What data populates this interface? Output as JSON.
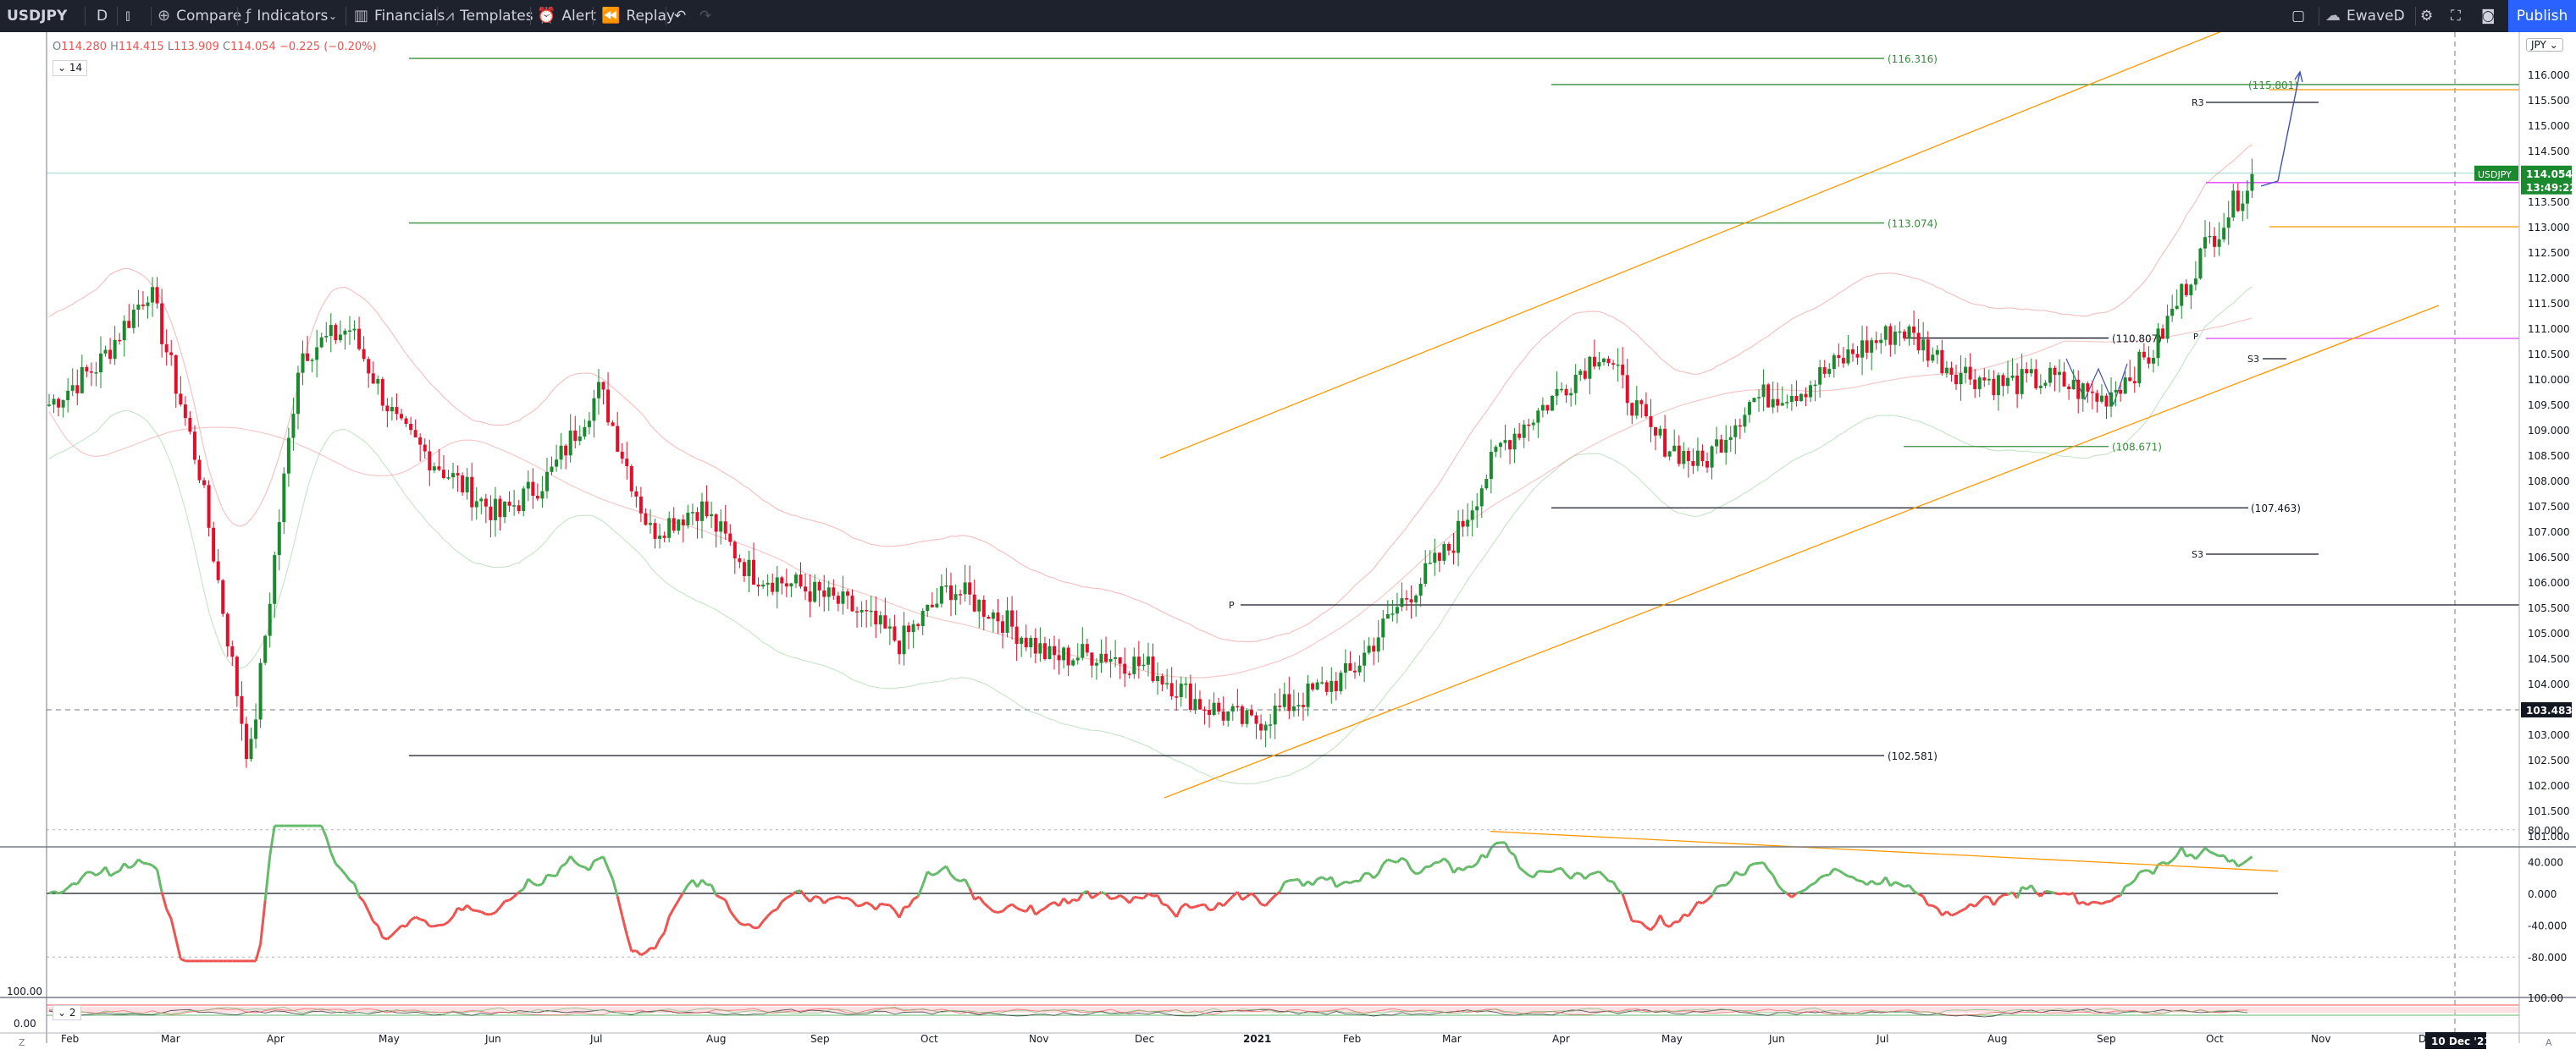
{
  "toolbar": {
    "symbol": "USDJPY",
    "interval": "D",
    "compare": "Compare",
    "indicators": "Indicators",
    "financials": "Financials",
    "templates": "Templates",
    "alert": "Alert",
    "replay": "Replay",
    "layout_name": "EwaveD",
    "publish": "Publish"
  },
  "legend": {
    "open_key": "O",
    "open": "114.280",
    "high_key": "H",
    "high": "114.415",
    "low_key": "L",
    "low": "113.909",
    "close_key": "C",
    "close": "114.054",
    "change": "−0.225 (−0.20%)",
    "indicator_param": "14",
    "sub_indicator_param": "2"
  },
  "currency": "JPY",
  "price_axis": {
    "ticks": [
      "116.000",
      "115.500",
      "115.000",
      "114.500",
      "114.000",
      "113.500",
      "113.000",
      "112.500",
      "112.000",
      "111.500",
      "111.000",
      "110.500",
      "110.000",
      "109.500",
      "109.000",
      "108.500",
      "108.000",
      "107.500",
      "107.000",
      "106.500",
      "106.000",
      "105.500",
      "105.000",
      "104.500",
      "104.000",
      "103.500",
      "103.000",
      "102.500",
      "102.000",
      "101.500",
      "101.000"
    ],
    "symbol_tag": "USDJPY",
    "last_price": "114.054",
    "countdown": "13:49:22",
    "crosshair_price": "103.483"
  },
  "osc_axis": {
    "ticks": [
      "80.000",
      "40.000",
      "0.000",
      "-40.000",
      "-80.000"
    ]
  },
  "sub_axis": {
    "left_top": "100.00",
    "left_bottom": "0.00",
    "right_top": "100.00"
  },
  "time_axis": {
    "labels": [
      "Feb",
      "Mar",
      "Apr",
      "May",
      "Jun",
      "Jul",
      "Aug",
      "Sep",
      "Oct",
      "Nov",
      "Dec",
      "2021",
      "Feb",
      "Mar",
      "Apr",
      "May",
      "Jun",
      "Jul",
      "Aug",
      "Sep",
      "Oct",
      "Nov",
      "Dec"
    ],
    "crosshair_date": "10 Dec '21",
    "scale_left": "Z",
    "scale_right": "A"
  },
  "levels": [
    {
      "label": "(116.316)",
      "color": "#388e3c"
    },
    {
      "label": "(115.801)",
      "color": "#388e3c"
    },
    {
      "label": "(113.074)",
      "color": "#388e3c"
    },
    {
      "label": "(110.807)",
      "color": "#131722"
    },
    {
      "label": "(108.671)",
      "color": "#388e3c"
    },
    {
      "label": "(107.463)",
      "color": "#131722"
    },
    {
      "label": "(102.581)",
      "color": "#131722"
    }
  ],
  "pivot_labels": {
    "r3": "R3",
    "s3_a": "S3",
    "s3_b": "S3",
    "p": "P",
    "p2": "P"
  },
  "chart_data": {
    "type": "candlestick",
    "symbol": "USDJPY",
    "ylim": [
      100.8,
      116.6
    ],
    "x": [
      "Feb",
      "Mar",
      "Apr",
      "May",
      "Jun",
      "Jul",
      "Aug",
      "Sep",
      "Oct",
      "Nov",
      "Dec",
      "2021",
      "Feb",
      "Mar",
      "Apr",
      "May",
      "Jun",
      "Jul",
      "Aug",
      "Sep",
      "Oct"
    ],
    "close_path": [
      109.5,
      110.3,
      111.8,
      108.2,
      102.4,
      110.5,
      111.0,
      109.0,
      108.1,
      107.3,
      108.1,
      109.8,
      107.0,
      107.5,
      106.2,
      105.9,
      105.5,
      104.8,
      105.9,
      105.3,
      104.5,
      104.6,
      104.3,
      103.6,
      103.2,
      103.7,
      104.2,
      105.6,
      106.7,
      108.7,
      109.6,
      110.6,
      108.9,
      108.3,
      109.6,
      109.8,
      110.5,
      111.0,
      110.2,
      109.9,
      110.0,
      109.6,
      110.5,
      112.5,
      114.0
    ],
    "oscillator": {
      "ylim": [
        -90,
        90
      ],
      "zero": 0
    },
    "current_price": 114.054
  }
}
